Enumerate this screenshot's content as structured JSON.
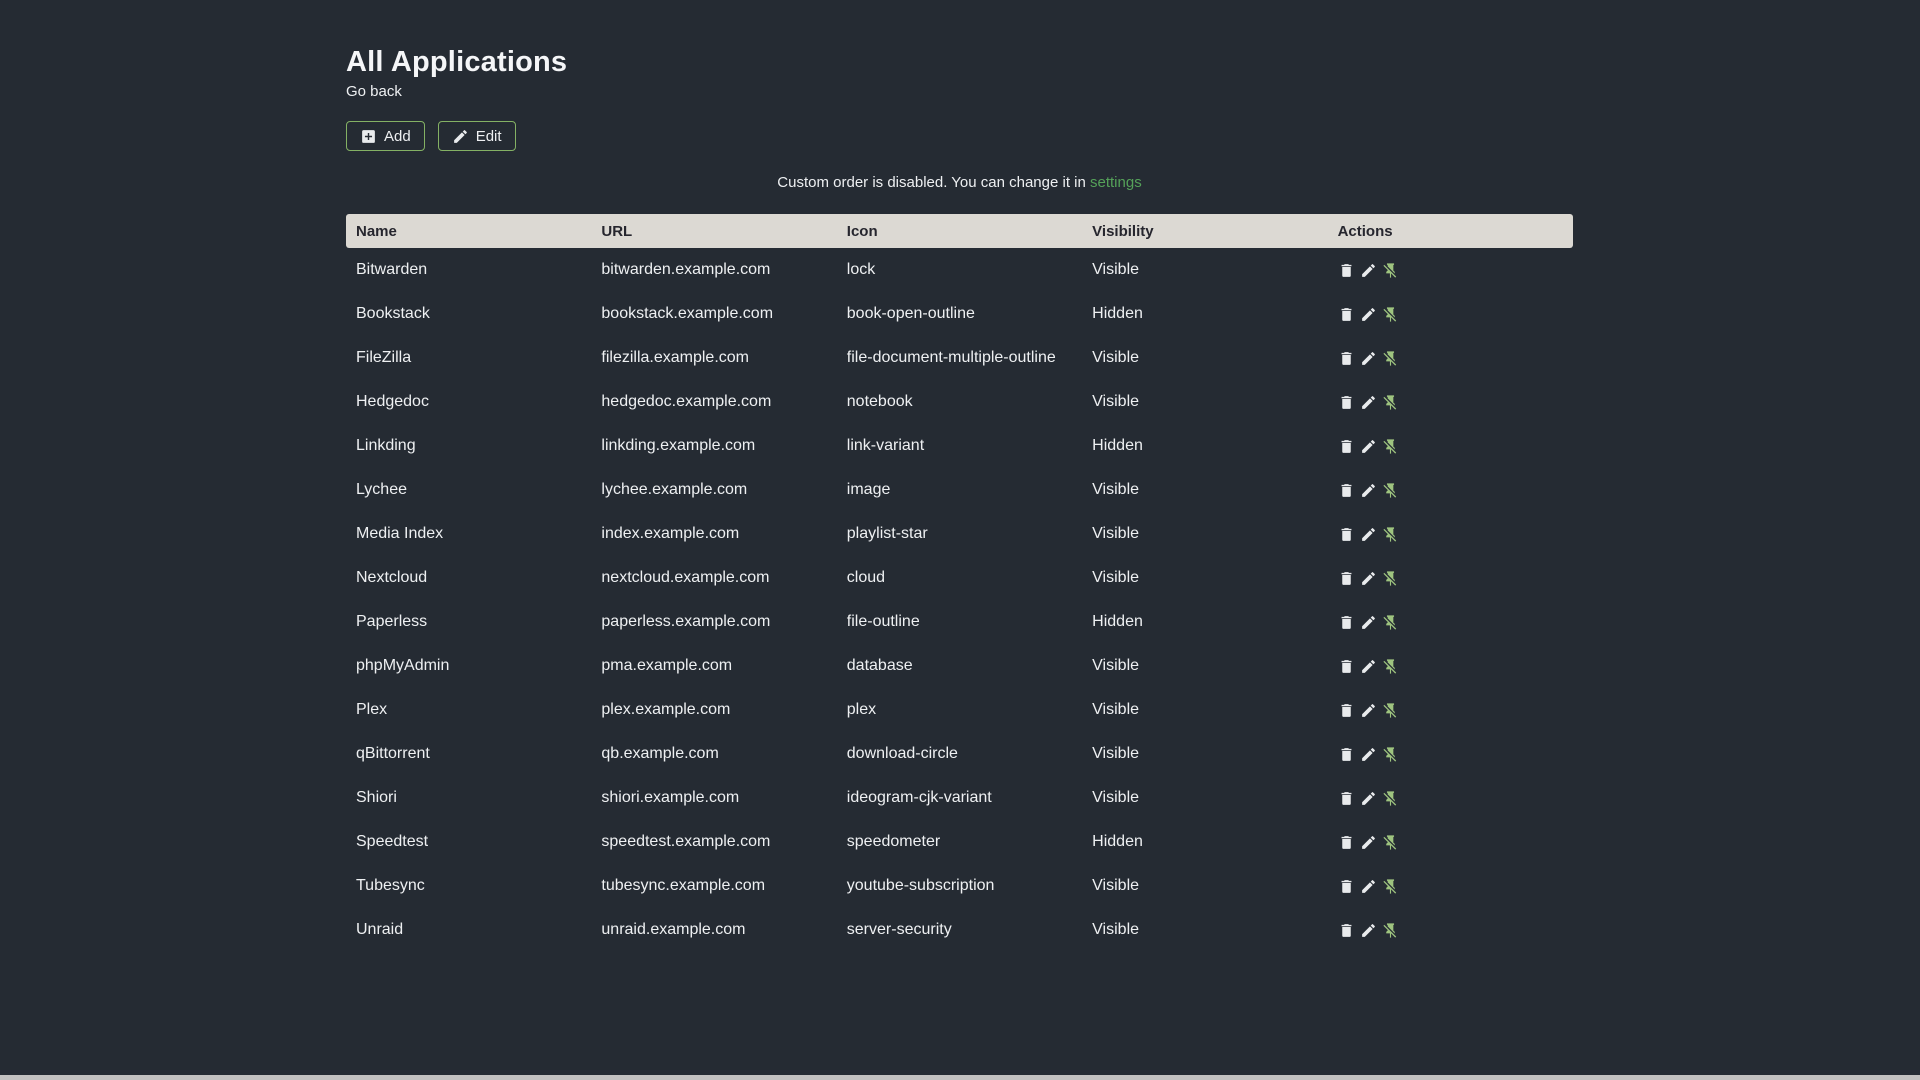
{
  "header": {
    "title": "All Applications",
    "back_link": "Go back"
  },
  "toolbar": {
    "add_label": "Add",
    "edit_label": "Edit"
  },
  "notice": {
    "text": "Custom order is disabled. You can change it in ",
    "link_label": "settings"
  },
  "table": {
    "columns": [
      "Name",
      "URL",
      "Icon",
      "Visibility",
      "Actions"
    ],
    "rows": [
      {
        "name": "Bitwarden",
        "url": "bitwarden.example.com",
        "icon": "lock",
        "visibility": "Visible"
      },
      {
        "name": "Bookstack",
        "url": "bookstack.example.com",
        "icon": "book-open-outline",
        "visibility": "Hidden"
      },
      {
        "name": "FileZilla",
        "url": "filezilla.example.com",
        "icon": "file-document-multiple-outline",
        "visibility": "Visible"
      },
      {
        "name": "Hedgedoc",
        "url": "hedgedoc.example.com",
        "icon": "notebook",
        "visibility": "Visible"
      },
      {
        "name": "Linkding",
        "url": "linkding.example.com",
        "icon": "link-variant",
        "visibility": "Hidden"
      },
      {
        "name": "Lychee",
        "url": "lychee.example.com",
        "icon": "image",
        "visibility": "Visible"
      },
      {
        "name": "Media Index",
        "url": "index.example.com",
        "icon": "playlist-star",
        "visibility": "Visible"
      },
      {
        "name": "Nextcloud",
        "url": "nextcloud.example.com",
        "icon": "cloud",
        "visibility": "Visible"
      },
      {
        "name": "Paperless",
        "url": "paperless.example.com",
        "icon": "file-outline",
        "visibility": "Hidden"
      },
      {
        "name": "phpMyAdmin",
        "url": "pma.example.com",
        "icon": "database",
        "visibility": "Visible"
      },
      {
        "name": "Plex",
        "url": "plex.example.com",
        "icon": "plex",
        "visibility": "Visible"
      },
      {
        "name": "qBittorrent",
        "url": "qb.example.com",
        "icon": "download-circle",
        "visibility": "Visible"
      },
      {
        "name": "Shiori",
        "url": "shiori.example.com",
        "icon": "ideogram-cjk-variant",
        "visibility": "Visible"
      },
      {
        "name": "Speedtest",
        "url": "speedtest.example.com",
        "icon": "speedometer",
        "visibility": "Hidden"
      },
      {
        "name": "Tubesync",
        "url": "tubesync.example.com",
        "icon": "youtube-subscription",
        "visibility": "Visible"
      },
      {
        "name": "Unraid",
        "url": "unraid.example.com",
        "icon": "server-security",
        "visibility": "Visible"
      }
    ],
    "row_actions": [
      "delete",
      "edit",
      "unpin"
    ]
  },
  "colors": {
    "background": "#252b33",
    "text": "#eef0f2",
    "accent_green": "#55a159",
    "icon_green": "#9ec47f",
    "button_border_green": "#84b164",
    "table_header_bg": "#dcd9d3",
    "table_header_text": "#26262e",
    "scrollbar_track": "#c2c1c0"
  }
}
